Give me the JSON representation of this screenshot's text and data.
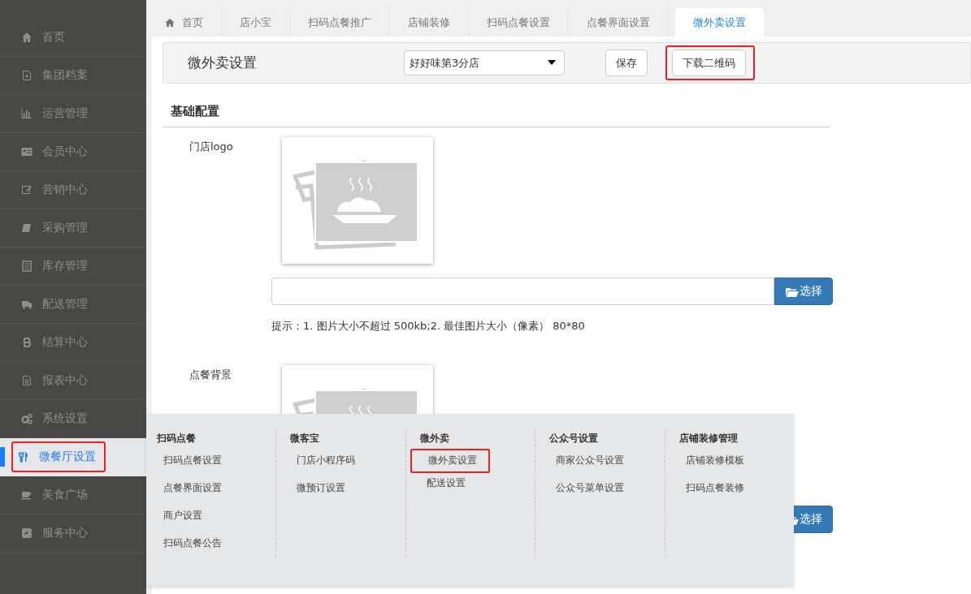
{
  "sidebar": {
    "items": [
      {
        "label": "首页",
        "selected": false,
        "highlighted": false
      },
      {
        "label": "集团档案",
        "selected": false,
        "highlighted": false
      },
      {
        "label": "运营管理",
        "selected": false,
        "highlighted": false
      },
      {
        "label": "会员中心",
        "selected": false,
        "highlighted": false
      },
      {
        "label": "营销中心",
        "selected": false,
        "highlighted": false
      },
      {
        "label": "采购管理",
        "selected": false,
        "highlighted": false
      },
      {
        "label": "库存管理",
        "selected": false,
        "highlighted": false
      },
      {
        "label": "配送管理",
        "selected": false,
        "highlighted": false
      },
      {
        "label": "结算中心",
        "selected": false,
        "highlighted": false
      },
      {
        "label": "报表中心",
        "selected": false,
        "highlighted": false
      },
      {
        "label": "系统设置",
        "selected": false,
        "highlighted": false
      },
      {
        "label": "微餐厅设置",
        "selected": true,
        "highlighted": true
      },
      {
        "label": "美食广场",
        "selected": false,
        "highlighted": false
      },
      {
        "label": "服务中心",
        "selected": false,
        "highlighted": false
      }
    ]
  },
  "tabs": [
    {
      "label": "首页",
      "selected": false
    },
    {
      "label": "店小宝",
      "selected": false
    },
    {
      "label": "扫码点餐推广",
      "selected": false
    },
    {
      "label": "店铺装修",
      "selected": false
    },
    {
      "label": "扫码点餐设置",
      "selected": false
    },
    {
      "label": "点餐界面设置",
      "selected": false
    },
    {
      "label": "微外卖设置",
      "selected": true
    }
  ],
  "toolbar": {
    "title": "微外卖设置",
    "store_select": {
      "value": "好好味第3分店"
    },
    "buttons": [
      {
        "label": "保存",
        "highlighted": false
      },
      {
        "label": "下载二维码",
        "highlighted": true
      }
    ]
  },
  "section": {
    "title": "基础配置",
    "fields": [
      {
        "kind": "full",
        "label": "门店logo",
        "button": "选择",
        "hint": "提示：1. 图片大小不超过 500kb;2. 最佳图片大小（像素） 80*80"
      },
      {
        "kind": "button_only",
        "label": "点餐背景",
        "button": "选择"
      }
    ]
  },
  "mega_menu": {
    "columns": [
      {
        "title": "扫码点餐",
        "items": [
          {
            "label": "扫码点餐设置",
            "highlighted": false
          },
          {
            "label": "点餐界面设置",
            "highlighted": false
          },
          {
            "label": "商户设置",
            "highlighted": false
          },
          {
            "label": "扫码点餐公告",
            "highlighted": false
          }
        ]
      },
      {
        "title": "微客宝",
        "items": [
          {
            "label": "门店小程序码",
            "highlighted": false
          },
          {
            "label": "微预订设置",
            "highlighted": false
          }
        ]
      },
      {
        "title": "微外卖",
        "items": [
          {
            "label": "微外卖设置",
            "highlighted": true
          },
          {
            "label": "配送设置",
            "highlighted": false
          }
        ]
      },
      {
        "title": "公众号设置",
        "items": [
          {
            "label": "商家公众号设置",
            "highlighted": false
          },
          {
            "label": "公众号菜单设置",
            "highlighted": false
          }
        ]
      },
      {
        "title": "店铺装修管理",
        "items": [
          {
            "label": "店铺装修模板",
            "highlighted": false
          },
          {
            "label": "扫码点餐装修",
            "highlighted": false
          }
        ]
      }
    ]
  }
}
